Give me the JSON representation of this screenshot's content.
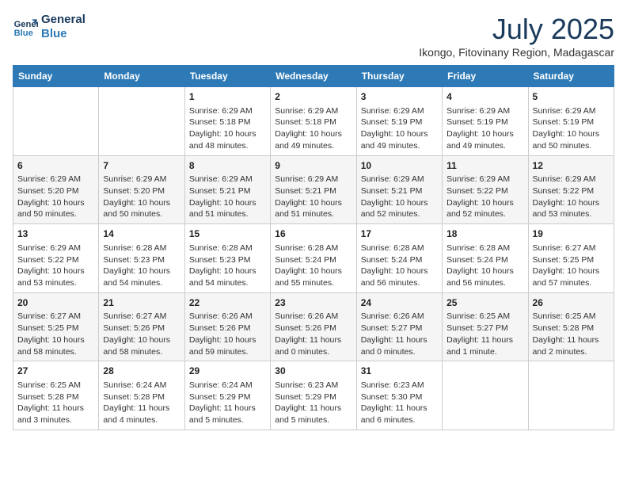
{
  "header": {
    "logo_line1": "General",
    "logo_line2": "Blue",
    "month_title": "July 2025",
    "subtitle": "Ikongo, Fitovinany Region, Madagascar"
  },
  "days_of_week": [
    "Sunday",
    "Monday",
    "Tuesday",
    "Wednesday",
    "Thursday",
    "Friday",
    "Saturday"
  ],
  "weeks": [
    [
      {
        "day": "",
        "info": ""
      },
      {
        "day": "",
        "info": ""
      },
      {
        "day": "1",
        "info": "Sunrise: 6:29 AM\nSunset: 5:18 PM\nDaylight: 10 hours and 48 minutes."
      },
      {
        "day": "2",
        "info": "Sunrise: 6:29 AM\nSunset: 5:18 PM\nDaylight: 10 hours and 49 minutes."
      },
      {
        "day": "3",
        "info": "Sunrise: 6:29 AM\nSunset: 5:19 PM\nDaylight: 10 hours and 49 minutes."
      },
      {
        "day": "4",
        "info": "Sunrise: 6:29 AM\nSunset: 5:19 PM\nDaylight: 10 hours and 49 minutes."
      },
      {
        "day": "5",
        "info": "Sunrise: 6:29 AM\nSunset: 5:19 PM\nDaylight: 10 hours and 50 minutes."
      }
    ],
    [
      {
        "day": "6",
        "info": "Sunrise: 6:29 AM\nSunset: 5:20 PM\nDaylight: 10 hours and 50 minutes."
      },
      {
        "day": "7",
        "info": "Sunrise: 6:29 AM\nSunset: 5:20 PM\nDaylight: 10 hours and 50 minutes."
      },
      {
        "day": "8",
        "info": "Sunrise: 6:29 AM\nSunset: 5:21 PM\nDaylight: 10 hours and 51 minutes."
      },
      {
        "day": "9",
        "info": "Sunrise: 6:29 AM\nSunset: 5:21 PM\nDaylight: 10 hours and 51 minutes."
      },
      {
        "day": "10",
        "info": "Sunrise: 6:29 AM\nSunset: 5:21 PM\nDaylight: 10 hours and 52 minutes."
      },
      {
        "day": "11",
        "info": "Sunrise: 6:29 AM\nSunset: 5:22 PM\nDaylight: 10 hours and 52 minutes."
      },
      {
        "day": "12",
        "info": "Sunrise: 6:29 AM\nSunset: 5:22 PM\nDaylight: 10 hours and 53 minutes."
      }
    ],
    [
      {
        "day": "13",
        "info": "Sunrise: 6:29 AM\nSunset: 5:22 PM\nDaylight: 10 hours and 53 minutes."
      },
      {
        "day": "14",
        "info": "Sunrise: 6:28 AM\nSunset: 5:23 PM\nDaylight: 10 hours and 54 minutes."
      },
      {
        "day": "15",
        "info": "Sunrise: 6:28 AM\nSunset: 5:23 PM\nDaylight: 10 hours and 54 minutes."
      },
      {
        "day": "16",
        "info": "Sunrise: 6:28 AM\nSunset: 5:24 PM\nDaylight: 10 hours and 55 minutes."
      },
      {
        "day": "17",
        "info": "Sunrise: 6:28 AM\nSunset: 5:24 PM\nDaylight: 10 hours and 56 minutes."
      },
      {
        "day": "18",
        "info": "Sunrise: 6:28 AM\nSunset: 5:24 PM\nDaylight: 10 hours and 56 minutes."
      },
      {
        "day": "19",
        "info": "Sunrise: 6:27 AM\nSunset: 5:25 PM\nDaylight: 10 hours and 57 minutes."
      }
    ],
    [
      {
        "day": "20",
        "info": "Sunrise: 6:27 AM\nSunset: 5:25 PM\nDaylight: 10 hours and 58 minutes."
      },
      {
        "day": "21",
        "info": "Sunrise: 6:27 AM\nSunset: 5:26 PM\nDaylight: 10 hours and 58 minutes."
      },
      {
        "day": "22",
        "info": "Sunrise: 6:26 AM\nSunset: 5:26 PM\nDaylight: 10 hours and 59 minutes."
      },
      {
        "day": "23",
        "info": "Sunrise: 6:26 AM\nSunset: 5:26 PM\nDaylight: 11 hours and 0 minutes."
      },
      {
        "day": "24",
        "info": "Sunrise: 6:26 AM\nSunset: 5:27 PM\nDaylight: 11 hours and 0 minutes."
      },
      {
        "day": "25",
        "info": "Sunrise: 6:25 AM\nSunset: 5:27 PM\nDaylight: 11 hours and 1 minute."
      },
      {
        "day": "26",
        "info": "Sunrise: 6:25 AM\nSunset: 5:28 PM\nDaylight: 11 hours and 2 minutes."
      }
    ],
    [
      {
        "day": "27",
        "info": "Sunrise: 6:25 AM\nSunset: 5:28 PM\nDaylight: 11 hours and 3 minutes."
      },
      {
        "day": "28",
        "info": "Sunrise: 6:24 AM\nSunset: 5:28 PM\nDaylight: 11 hours and 4 minutes."
      },
      {
        "day": "29",
        "info": "Sunrise: 6:24 AM\nSunset: 5:29 PM\nDaylight: 11 hours and 5 minutes."
      },
      {
        "day": "30",
        "info": "Sunrise: 6:23 AM\nSunset: 5:29 PM\nDaylight: 11 hours and 5 minutes."
      },
      {
        "day": "31",
        "info": "Sunrise: 6:23 AM\nSunset: 5:30 PM\nDaylight: 11 hours and 6 minutes."
      },
      {
        "day": "",
        "info": ""
      },
      {
        "day": "",
        "info": ""
      }
    ]
  ]
}
